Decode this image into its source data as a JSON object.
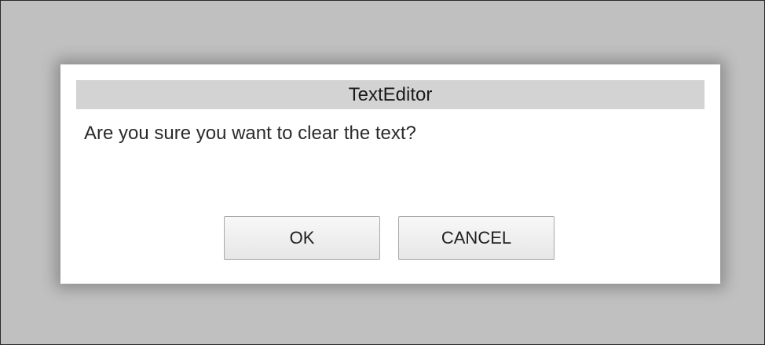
{
  "dialog": {
    "title": "TextEditor",
    "message": "Are you sure you want to clear the text?",
    "ok_label": "OK",
    "cancel_label": "CANCEL"
  },
  "colors": {
    "backdrop": "#c0c0c0",
    "dialog_background": "#ffffff",
    "title_bar": "#d3d3d3"
  }
}
